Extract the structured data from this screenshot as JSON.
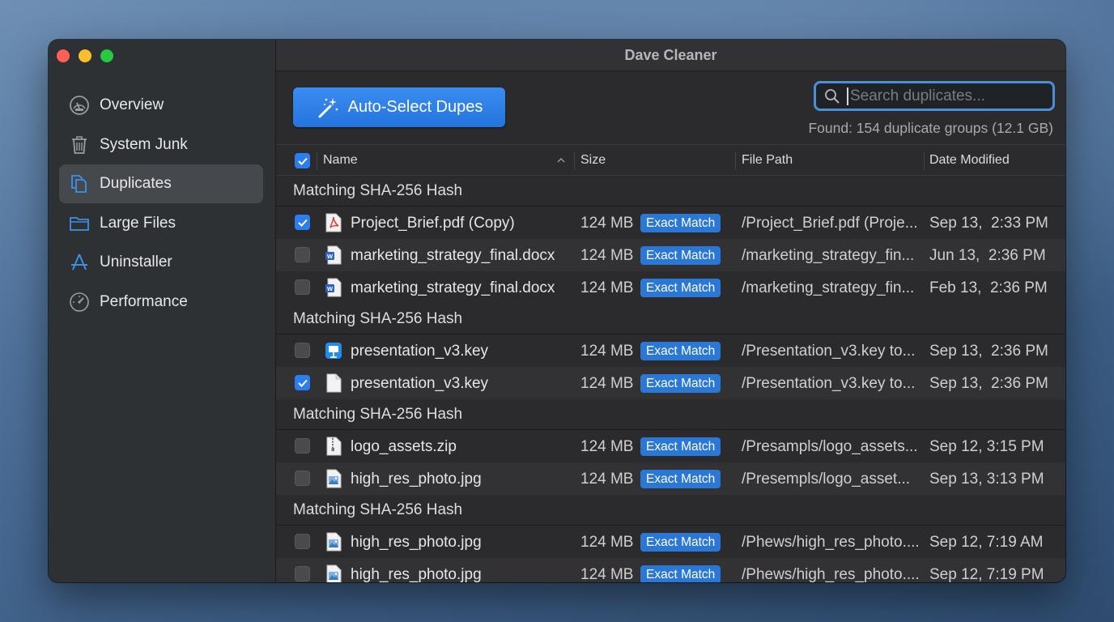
{
  "window": {
    "title": "Dave Cleaner"
  },
  "sidebar": {
    "items": [
      {
        "label": "Overview",
        "icon": "gauge-icon",
        "active": false
      },
      {
        "label": "System Junk",
        "icon": "trash-icon",
        "active": false
      },
      {
        "label": "Duplicates",
        "icon": "duplicate-files-icon",
        "active": true
      },
      {
        "label": "Large Files",
        "icon": "folder-icon",
        "active": false
      },
      {
        "label": "Uninstaller",
        "icon": "app-store-icon",
        "active": false
      },
      {
        "label": "Performance",
        "icon": "speedometer-icon",
        "active": false
      }
    ]
  },
  "toolbar": {
    "auto_select_label": "Auto-Select Dupes",
    "search_placeholder": "Search duplicates...",
    "found_text": "Found: 154 duplicate groups (12.1 GB)"
  },
  "table": {
    "columns": {
      "name": "Name",
      "size": "Size",
      "path": "File Path",
      "date": "Date Modified"
    },
    "groups": [
      {
        "label": "Matching SHA-256 Hash",
        "rows": [
          {
            "checked": true,
            "icon": "pdf-icon",
            "name": "Project_Brief.pdf (Copy)",
            "size": "124 MB",
            "badge": "Exact Match",
            "path": "/Project_Brief.pdf (Proje...",
            "date": "Sep 13,  2:33 PM"
          },
          {
            "checked": false,
            "icon": "word-doc-icon",
            "name": "marketing_strategy_final.docx",
            "size": "124 MB",
            "badge": "Exact Match",
            "path": "/marketing_strategy_fin...",
            "date": "Jun 13,  2:36 PM"
          },
          {
            "checked": false,
            "icon": "word-doc-icon",
            "name": "marketing_strategy_final.docx",
            "size": "124 MB",
            "badge": "Exact Match",
            "path": "/marketing_strategy_fin...",
            "date": "Feb 13,  2:36 PM"
          }
        ]
      },
      {
        "label": "Matching SHA-256 Hash",
        "rows": [
          {
            "checked": false,
            "icon": "keynote-icon",
            "name": "presentation_v3.key",
            "size": "124 MB",
            "badge": "Exact Match",
            "path": "/Presentation_v3.key to...",
            "date": "Sep 13,  2:36 PM"
          },
          {
            "checked": true,
            "icon": "blank-doc-icon",
            "name": "presentation_v3.key",
            "size": "124 MB",
            "badge": "Exact Match",
            "path": "/Presentation_v3.key to...",
            "date": "Sep 13,  2:36 PM"
          }
        ]
      },
      {
        "label": "Matching SHA-256 Hash",
        "rows": [
          {
            "checked": false,
            "icon": "zip-icon",
            "name": "logo_assets.zip",
            "size": "124 MB",
            "badge": "Exact Match",
            "path": "/Presampls/logo_assets...",
            "date": "Sep 12, 3:15 PM"
          },
          {
            "checked": false,
            "icon": "image-icon",
            "name": "high_res_photo.jpg",
            "size": "124 MB",
            "badge": "Exact Match",
            "path": "/Presempls/logo_asset...",
            "date": "Sep 13, 3:13 PM"
          }
        ]
      },
      {
        "label": "Matching SHA-256 Hash",
        "rows": [
          {
            "checked": false,
            "icon": "image-icon",
            "name": "high_res_photo.jpg",
            "size": "124 MB",
            "badge": "Exact Match",
            "path": "/Phews/high_res_photo....",
            "date": "Sep 12, 7:19 AM"
          },
          {
            "checked": false,
            "icon": "image-icon",
            "name": "high_res_photo.jpg",
            "size": "124 MB",
            "badge": "Exact Match",
            "path": "/Phews/high_res_photo....",
            "date": "Sep 12, 7:19 PM"
          }
        ]
      }
    ]
  },
  "colors": {
    "accent": "#2b7ef0",
    "badge": "#2a77d6",
    "close": "#ff5f57",
    "minimize": "#febc2e",
    "maximize": "#28c840"
  }
}
